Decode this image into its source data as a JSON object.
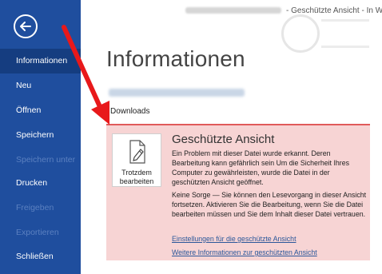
{
  "sidebar": {
    "items": [
      {
        "label": "Informationen",
        "state": "active"
      },
      {
        "label": "Neu",
        "state": "normal"
      },
      {
        "label": "Öffnen",
        "state": "normal"
      },
      {
        "label": "Speichern",
        "state": "normal"
      },
      {
        "label": "Speichern unter",
        "state": "disabled"
      },
      {
        "label": "Drucken",
        "state": "normal"
      },
      {
        "label": "Freigeben",
        "state": "disabled"
      },
      {
        "label": "Exportieren",
        "state": "disabled"
      },
      {
        "label": "Schließen",
        "state": "normal"
      }
    ]
  },
  "titlebar": {
    "text": "- Geschützte Ansicht - In Wor"
  },
  "main": {
    "title": "Informationen",
    "folder": "Downloads"
  },
  "protected_view": {
    "button_label": "Trotzdem bearbeiten",
    "title": "Geschützte Ansicht",
    "paragraph1": "Ein Problem mit dieser Datei wurde erkannt. Deren Bearbeitung kann gefährlich sein Um die Sicherheit Ihres Computer zu gewährleisten, wurde die Datei in der geschützten Ansicht geöffnet.",
    "paragraph2": "Keine Sorge — Sie können den Lesevorgang in dieser Ansicht fortsetzen. Aktivieren Sie die Bearbeitung, wenn Sie die Datei bearbeiten müssen und Sie dem Inhalt dieser Datei vertrauen.",
    "link1": "Einstellungen für die geschützte Ansicht",
    "link2": "Weitere Informationen zur geschützten Ansicht"
  },
  "colors": {
    "sidebar": "#1f4e9e",
    "sidebar_active": "#153d80",
    "panel_bg": "#f7d4d4",
    "panel_border": "#e05a5a",
    "link": "#2b579a",
    "arrow": "#e8191b"
  },
  "icons": {
    "back": "back-arrow-icon",
    "edit": "edit-document-icon"
  }
}
